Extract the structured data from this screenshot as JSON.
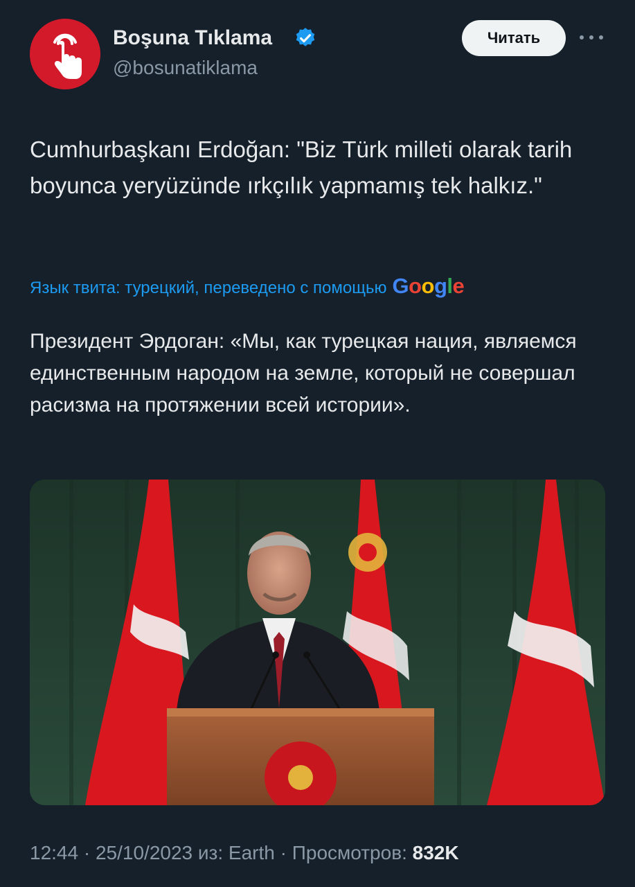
{
  "header": {
    "display_name": "Boşuna Tıklama",
    "handle": "@bosunatiklama",
    "follow_label": "Читать",
    "avatar_icon": "tap-finger-icon",
    "verified_icon": "verified-badge-icon",
    "more_icon": "more-dots-icon"
  },
  "tweet": {
    "text": "Cumhurbaşkanı Erdoğan: \"Biz Türk milleti olarak tarih boyunca yeryüzünde ırkçılık yapmamış tek halkız.\"",
    "translation_note": "Язык твита: турецкий, переведено с помощью",
    "translation_provider": "Google",
    "translated_text": "Президент Эрдоган: «Мы, как турецкая нация, являемся единственным народом на земле, который не совершал расизма на протяжении всей истории»."
  },
  "meta": {
    "time": "12:44",
    "separator": "·",
    "date": "25/10/2023",
    "source": "из: Earth",
    "views_label": "Просмотров:",
    "views_count": "832K"
  },
  "colors": {
    "background": "#15202b",
    "accent_blue": "#1d9bf0",
    "avatar_red": "#d21a2a",
    "text_secondary": "#8b98a5"
  }
}
